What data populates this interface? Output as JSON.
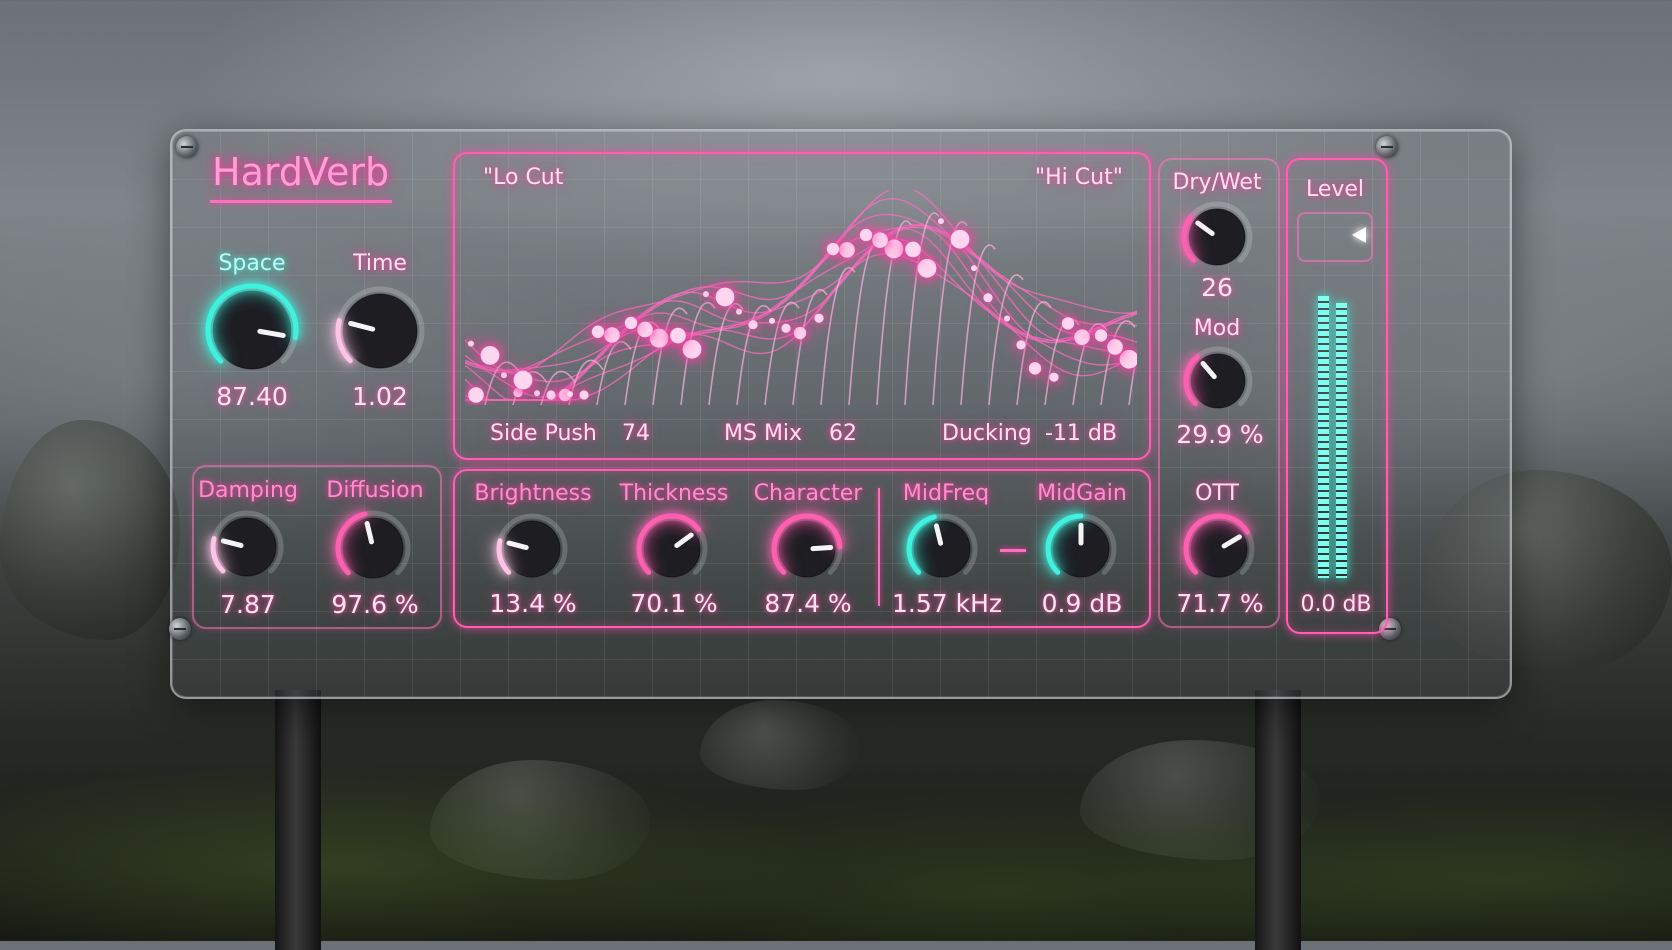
{
  "plugin": {
    "title": "HardVerb"
  },
  "display": {
    "lo_cut_label": "\"Lo Cut",
    "hi_cut_label": "\"Hi Cut\"",
    "side_push_label": "Side Push",
    "side_push_value": "74",
    "ms_mix_label": "MS Mix",
    "ms_mix_value": "62",
    "ducking_label": "Ducking",
    "ducking_value": "-11 dB"
  },
  "knobs": {
    "space": {
      "label": "Space",
      "value": "87.40",
      "level": 0.87,
      "color": "#3ef2e0"
    },
    "time": {
      "label": "Time",
      "value": "1.02",
      "level": 0.22,
      "color": "#ffc3e6"
    },
    "damping": {
      "label": "Damping",
      "value": "7.87",
      "level": 0.22,
      "color": "#ffc3e6"
    },
    "diffusion": {
      "label": "Diffusion",
      "value": "97.6 %",
      "level": 0.45,
      "color": "#ff5fb0"
    },
    "brightness": {
      "label": "Brightness",
      "value": "13.4 %",
      "level": 0.22,
      "color": "#ffc3e6"
    },
    "thickness": {
      "label": "Thickness",
      "value": "70.1 %",
      "level": 0.7,
      "color": "#ff5fb0"
    },
    "character": {
      "label": "Character",
      "value": "87.4 %",
      "level": 0.82,
      "color": "#ff5fb0"
    },
    "midfreq": {
      "label": "MidFreq",
      "value": "1.57 kHz",
      "level": 0.45,
      "color": "#3ef2e0"
    },
    "midgain": {
      "label": "MidGain",
      "value": "0.9 dB",
      "level": 0.5,
      "color": "#3ef2e0"
    },
    "drywet": {
      "label": "Dry/Wet",
      "value": "26",
      "level": 0.3,
      "color": "#ff5fb0"
    },
    "mod": {
      "label": "Mod",
      "value": "29.9 %",
      "level": 0.35,
      "color": "#ff5fb0"
    },
    "ott": {
      "label": "OTT",
      "value": "71.7 %",
      "level": 0.72,
      "color": "#ff5fb0"
    }
  },
  "level_meter": {
    "label": "Level",
    "value": "0.0 dB",
    "left_level": 0.92,
    "right_level": 0.9
  },
  "colors": {
    "accent": "#ff5fb0",
    "meter": "#3ef2e0"
  }
}
